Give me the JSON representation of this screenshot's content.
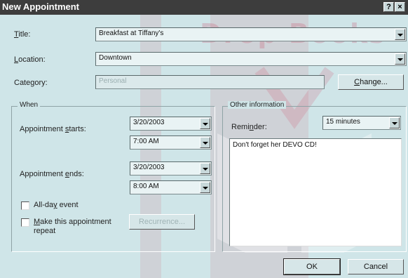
{
  "window": {
    "title": "New Appointment",
    "help_btn": "?",
    "close_btn": "×"
  },
  "watermark": {
    "text": "Drop Books"
  },
  "title": {
    "label": "Title:",
    "value": "Breakfast at Tiffany's"
  },
  "location": {
    "label": "Location:",
    "value": "Downtown"
  },
  "category": {
    "label": "Category:",
    "value": "Personal",
    "change_btn": "Change..."
  },
  "when": {
    "legend": "When",
    "starts_label": "Appointment starts:",
    "start_date": "3/20/2003",
    "start_time": "7:00 AM",
    "ends_label": "Appointment ends:",
    "end_date": "3/20/2003",
    "end_time": "8:00 AM",
    "all_day_label": "All-day event",
    "repeat_label_1": "Make this appointment",
    "repeat_label_2": "repeat",
    "recurrence_btn": "Recurrence..."
  },
  "other": {
    "legend": "Other information",
    "reminder_label": "Reminder:",
    "reminder_value": "15 minutes",
    "notes": "Don't forget her DEVO CD!"
  },
  "footer": {
    "ok": "OK",
    "cancel": "Cancel"
  }
}
